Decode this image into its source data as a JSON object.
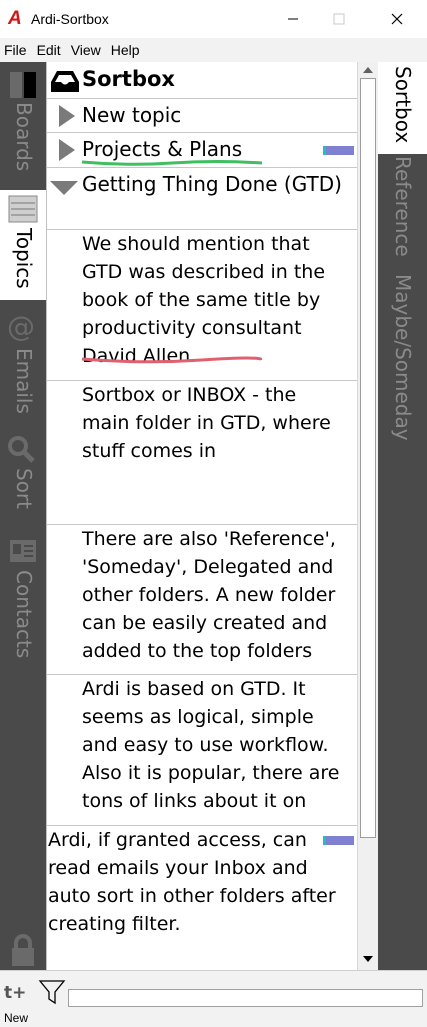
{
  "window": {
    "logo": "A",
    "title": "Ardi-Sortbox"
  },
  "menu": [
    "File",
    "Edit",
    "View",
    "Help"
  ],
  "left_tabs": [
    {
      "label": "Boards",
      "icon": "boards-icon",
      "active": false
    },
    {
      "label": "Topics",
      "icon": "topics-icon",
      "active": true
    },
    {
      "label": "Emails",
      "icon": "at-icon",
      "active": false
    },
    {
      "label": "Sort",
      "icon": "search-icon",
      "active": false
    },
    {
      "label": "Contacts",
      "icon": "contact-card-icon",
      "active": false
    }
  ],
  "main": {
    "header": {
      "label": "Sortbox",
      "icon": "inbox-tray-icon"
    },
    "topics": [
      {
        "label": "New topic",
        "expanded": false
      },
      {
        "label": "Projects & Plans",
        "expanded": false,
        "underline_color": "#3fbf5f",
        "marker_color": "#8080d0"
      },
      {
        "label": "Getting Thing Done (GTD)",
        "expanded": true
      }
    ],
    "notes": [
      {
        "lines": [
          "We should mention that",
          "GTD was described in the",
          "book of the same title by",
          "productivity consultant",
          "David Allen."
        ],
        "underline_color": "#e06070"
      },
      {
        "lines": [
          "Sortbox or INBOX - the",
          "main folder in GTD, where",
          "stuff comes in"
        ]
      },
      {
        "lines": [
          "There are also 'Reference',",
          "'Someday', Delegated and",
          "other folders. A new folder",
          "can be easily created and",
          "added to the top folders"
        ]
      },
      {
        "lines": [
          "Ardi is based on GTD. It",
          "seems as logical, simple",
          "and easy to use workflow.",
          "Also it is popular, there are",
          "tons of links about it on"
        ]
      },
      {
        "lines": [
          "Ardi, if granted access, can",
          "read emails your Inbox and",
          "auto sort in other folders after",
          "creating filter."
        ],
        "marker_color": "#8080d0"
      }
    ]
  },
  "right_tabs": [
    {
      "label": "Sortbox",
      "active": true
    },
    {
      "label": "Reference",
      "active": false
    },
    {
      "label": "Maybe/Someday",
      "active": false
    }
  ],
  "bottom": {
    "new_topic_glyph": "t+",
    "new_label": "New",
    "filter_icon": "filter-funnel-icon",
    "lock_icon": "lock-icon"
  },
  "colors": {
    "strip_bg": "#4a4a4a",
    "inactive_tab_text": "#8a8a8a",
    "logo_red": "#d01818"
  }
}
